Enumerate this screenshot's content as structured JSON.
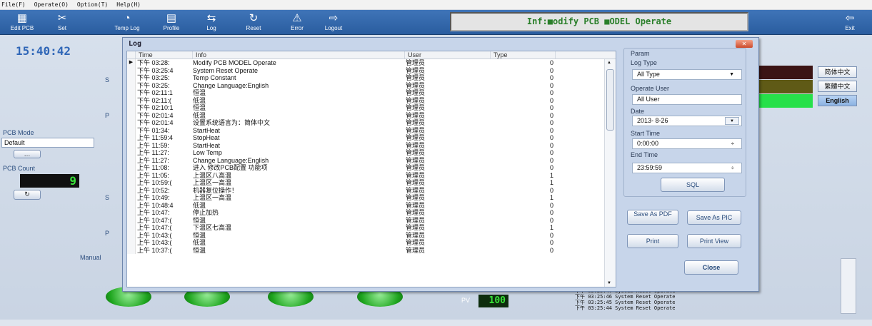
{
  "menu": [
    "File(F)",
    "Operate(O)",
    "Option(T)",
    "Help(H)"
  ],
  "toolbar": [
    {
      "label": "Edit PCB",
      "icon": "pcb-edit-icon",
      "glyph": "▦"
    },
    {
      "label": "Set",
      "icon": "tools-icon",
      "glyph": "✂"
    },
    {
      "label": "Temp Log",
      "icon": "temp-log-icon",
      "glyph": "◔"
    },
    {
      "label": "Profile",
      "icon": "profile-icon",
      "glyph": "▤"
    },
    {
      "label": "Log",
      "icon": "log-icon",
      "glyph": "⇆"
    },
    {
      "label": "Reset",
      "icon": "reset-icon",
      "glyph": "↻"
    },
    {
      "label": "Error",
      "icon": "warning-icon",
      "glyph": "⚠"
    },
    {
      "label": "Logout",
      "icon": "logout-icon",
      "glyph": "⇨"
    }
  ],
  "exit_label": "Exit",
  "info": "Inf:■odify PCB ■ODEL Operate",
  "clock": "15:40:42",
  "pcb_mode_label": "PCB Mode",
  "pcb_mode_value": "Default",
  "pcb_count_label": "PCB Count",
  "pcb_count_value": "9",
  "manual_label": "Manual",
  "pv_label": "PV",
  "pv_value": "100",
  "languages": [
    "简体中文",
    "繁體中文",
    "English"
  ],
  "bottom_log": [
    "下午 03:25:47 System Reset Operate",
    "下午 03:25:46 System Reset Operate",
    "下午 03:25:45 System Reset Operate",
    "下午 03:25:44 System Reset Operate"
  ],
  "dialog": {
    "title": "Log",
    "columns": [
      "Time",
      "Info",
      "User",
      "Type"
    ],
    "rows": [
      [
        "下午 03:28:",
        "Modify PCB MODEL Operate",
        "管理员",
        "0"
      ],
      [
        "下午 03:25:4",
        "System Reset Operate",
        "管理员",
        "0"
      ],
      [
        "下午 03:25:",
        "Temp Constant",
        "管理员",
        "0"
      ],
      [
        "下午 03:25:",
        "Change Language:English",
        "管理员",
        "0"
      ],
      [
        "下午 02:11:1",
        "恒温",
        "管理员",
        "0"
      ],
      [
        "下午 02:11:(",
        "低温",
        "管理员",
        "0"
      ],
      [
        "下午 02:10:1",
        "恒温",
        "管理员",
        "0"
      ],
      [
        "下午 02:01:4",
        "低温",
        "管理员",
        "0"
      ],
      [
        "下午 02:01:4",
        "设置系统语言为：简体中文",
        "管理员",
        "0"
      ],
      [
        "下午 01:34:",
        "StartHeat",
        "管理员",
        "0"
      ],
      [
        "上午 11:59:4",
        "StopHeat",
        "管理员",
        "0"
      ],
      [
        "上午 11:59:",
        "StartHeat",
        "管理员",
        "0"
      ],
      [
        "上午 11:27:",
        "Low Temp",
        "管理员",
        "0"
      ],
      [
        "上午 11:27:",
        "Change Language:English",
        "管理员",
        "0"
      ],
      [
        "上午 11:08:",
        "进入 修改PCB配置 功能项",
        "管理员",
        "0"
      ],
      [
        "上午 11:05:",
        "上温区八高温",
        "管理员",
        "1"
      ],
      [
        "上午 10:59:(",
        "上温区一高温",
        "管理员",
        "1"
      ],
      [
        "上午 10:52:",
        "机器复位操作！",
        "管理员",
        "0"
      ],
      [
        "上午 10:49:",
        "上温区一高温",
        "管理员",
        "1"
      ],
      [
        "上午 10:48:4",
        "低温",
        "管理员",
        "0"
      ],
      [
        "上午 10:47:",
        "停止加热",
        "管理员",
        "0"
      ],
      [
        "上午 10:47:(",
        "恒温",
        "管理员",
        "0"
      ],
      [
        "上午 10:47:(",
        "下温区七高温",
        "管理员",
        "1"
      ],
      [
        "上午 10:43:(",
        "恒温",
        "管理员",
        "0"
      ],
      [
        "上午 10:43:(",
        "低温",
        "管理员",
        "0"
      ],
      [
        "上午 10:37:(",
        "恒温",
        "管理员",
        "0"
      ]
    ],
    "param": {
      "title": "Param",
      "log_type_label": "Log Type",
      "log_type_value": "All Type",
      "operate_user_label": "Operate User",
      "operate_user_value": "All User",
      "date_label": "Date",
      "date_value": "2013- 8-26",
      "start_label": "Start Time",
      "start_value": "0:00:00",
      "end_label": "End  Time",
      "end_value": "23:59:59",
      "sql_label": "SQL"
    },
    "buttons": {
      "save_pdf": "Save As PDF",
      "save_pic": "Save As PIC",
      "print": "Print",
      "print_view": "Print View",
      "close": "Close"
    }
  }
}
